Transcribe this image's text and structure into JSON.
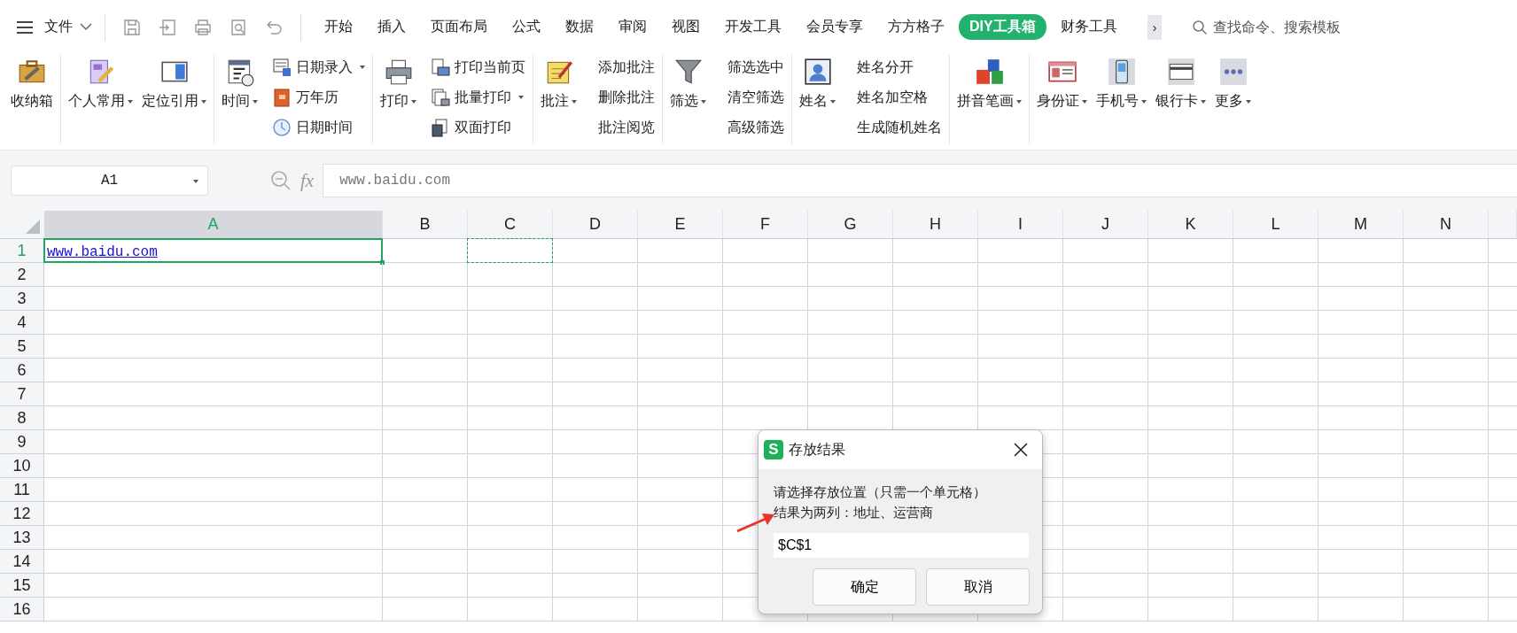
{
  "menu": {
    "label": "文件"
  },
  "tabs": [
    {
      "label": "开始",
      "selected": false
    },
    {
      "label": "插入",
      "selected": false
    },
    {
      "label": "页面布局",
      "selected": false
    },
    {
      "label": "公式",
      "selected": false
    },
    {
      "label": "数据",
      "selected": false
    },
    {
      "label": "审阅",
      "selected": false
    },
    {
      "label": "视图",
      "selected": false
    },
    {
      "label": "开发工具",
      "selected": false
    },
    {
      "label": "会员专享",
      "selected": false
    },
    {
      "label": "方方格子",
      "selected": false
    },
    {
      "label": "DIY工具箱",
      "selected": true
    },
    {
      "label": "财务工具",
      "selected": false
    }
  ],
  "more_tabs": "›",
  "search": {
    "placeholder": "查找命令、搜索模板"
  },
  "ribbon": [
    {
      "items": [
        {
          "kind": "large",
          "label": "收纳箱",
          "dropdown": false
        }
      ]
    },
    {
      "items": [
        {
          "kind": "large",
          "label": "个人常用",
          "dropdown": true
        },
        {
          "kind": "large",
          "label": "定位引用",
          "dropdown": true
        }
      ]
    },
    {
      "items": [
        {
          "kind": "large",
          "label": "时间",
          "dropdown": true
        },
        {
          "kind": "small",
          "label": "日期录入",
          "dropdown": true
        },
        {
          "kind": "small",
          "label": "万年历",
          "dropdown": false
        },
        {
          "kind": "small",
          "label": "日期时间",
          "dropdown": false
        }
      ]
    },
    {
      "items": [
        {
          "kind": "large",
          "label": "打印",
          "dropdown": true
        },
        {
          "kind": "small",
          "label": "打印当前页",
          "dropdown": false
        },
        {
          "kind": "small",
          "label": "批量打印",
          "dropdown": true
        },
        {
          "kind": "small",
          "label": "双面打印",
          "dropdown": false
        }
      ]
    },
    {
      "items": [
        {
          "kind": "large",
          "label": "批注",
          "dropdown": true
        },
        {
          "kind": "text",
          "label": "添加批注",
          "dropdown": false
        },
        {
          "kind": "text",
          "label": "删除批注",
          "dropdown": false
        },
        {
          "kind": "text",
          "label": "批注阅览",
          "dropdown": false
        }
      ]
    },
    {
      "items": [
        {
          "kind": "large",
          "label": "筛选",
          "dropdown": true
        },
        {
          "kind": "text",
          "label": "筛选选中",
          "dropdown": false
        },
        {
          "kind": "text",
          "label": "清空筛选",
          "dropdown": false
        },
        {
          "kind": "text",
          "label": "高级筛选",
          "dropdown": false
        }
      ]
    },
    {
      "items": [
        {
          "kind": "large",
          "label": "姓名",
          "dropdown": true
        },
        {
          "kind": "text",
          "label": "姓名分开",
          "dropdown": false
        },
        {
          "kind": "text",
          "label": "姓名加空格",
          "dropdown": false
        },
        {
          "kind": "text",
          "label": "生成随机姓名",
          "dropdown": false
        }
      ]
    },
    {
      "items": [
        {
          "kind": "large",
          "label": "拼音笔画",
          "dropdown": true
        }
      ]
    },
    {
      "items": [
        {
          "kind": "large",
          "label": "身份证",
          "dropdown": true
        },
        {
          "kind": "large",
          "label": "手机号",
          "dropdown": true
        },
        {
          "kind": "large",
          "label": "银行卡",
          "dropdown": true
        },
        {
          "kind": "large",
          "label": "更多",
          "dropdown": true
        }
      ]
    }
  ],
  "name_box": {
    "value": "A1"
  },
  "formula_bar": {
    "label": "fx",
    "value": "www.baidu.com"
  },
  "sheet": {
    "columns": [
      {
        "label": "A",
        "selected": true
      },
      {
        "label": "B",
        "selected": false
      },
      {
        "label": "C",
        "selected": false
      },
      {
        "label": "D",
        "selected": false
      },
      {
        "label": "E",
        "selected": false
      },
      {
        "label": "F",
        "selected": false
      },
      {
        "label": "G",
        "selected": false
      },
      {
        "label": "H",
        "selected": false
      },
      {
        "label": "I",
        "selected": false
      },
      {
        "label": "J",
        "selected": false
      },
      {
        "label": "K",
        "selected": false
      },
      {
        "label": "L",
        "selected": false
      },
      {
        "label": "M",
        "selected": false
      },
      {
        "label": "N",
        "selected": false
      }
    ],
    "rows": [
      {
        "label": "1",
        "selected": true,
        "cells": [
          {
            "kind": "link",
            "value": "www.baidu.com",
            "active": true
          },
          {
            "kind": "blank"
          },
          {
            "kind": "marquee"
          }
        ]
      },
      {
        "label": "2",
        "selected": false
      },
      {
        "label": "3",
        "selected": false
      },
      {
        "label": "4",
        "selected": false
      },
      {
        "label": "5",
        "selected": false
      },
      {
        "label": "6",
        "selected": false
      },
      {
        "label": "7",
        "selected": false
      },
      {
        "label": "8",
        "selected": false
      },
      {
        "label": "9",
        "selected": false
      },
      {
        "label": "10",
        "selected": false
      },
      {
        "label": "11",
        "selected": false
      },
      {
        "label": "12",
        "selected": false
      },
      {
        "label": "13",
        "selected": false
      },
      {
        "label": "14",
        "selected": false
      },
      {
        "label": "15",
        "selected": false
      },
      {
        "label": "16",
        "selected": false
      }
    ]
  },
  "dialog": {
    "logo": "S",
    "title": "存放结果",
    "message": [
      "请选择存放位置（只需一个单元格）",
      "结果为两列：地址、运营商"
    ],
    "input": {
      "value": "$C$1"
    },
    "buttons": [
      {
        "label": "确定"
      },
      {
        "label": "取消"
      }
    ]
  }
}
